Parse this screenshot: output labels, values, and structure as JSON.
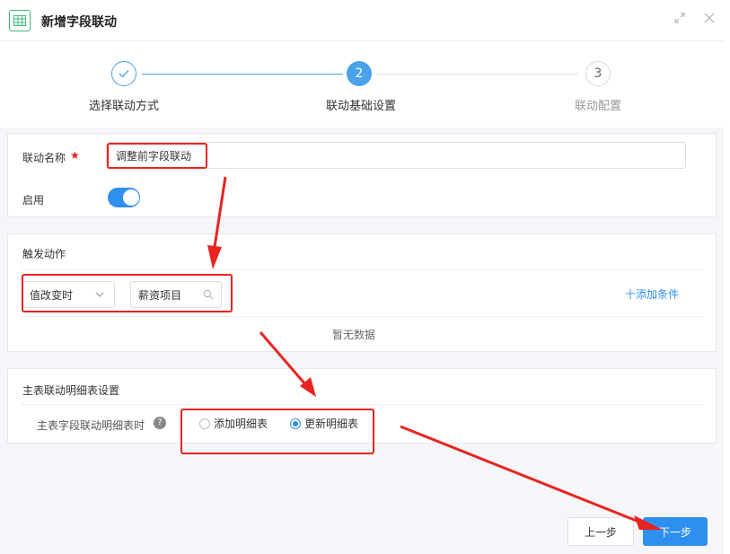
{
  "window": {
    "title": "新增字段联动",
    "app_icon": "table-icon",
    "expand_icon": "expand-icon",
    "close_icon": "close-icon"
  },
  "steps": [
    {
      "label": "选择联动方式",
      "state": "done",
      "number": ""
    },
    {
      "label": "联动基础设置",
      "state": "active",
      "number": "2"
    },
    {
      "label": "联动配置",
      "state": "pending",
      "number": "3"
    }
  ],
  "basic": {
    "name_label": "联动名称",
    "required_mark": "★",
    "name_value": "调整前字段联动",
    "enable_label": "启用",
    "enable_on": true
  },
  "trigger": {
    "title": "触发动作",
    "condition_select": "值改变时",
    "field_value": "薪资项目",
    "add_condition": "十添加条件",
    "empty_text": "暂无数据"
  },
  "detail": {
    "title": "主表联动明细表设置",
    "field_label": "主表字段联动明细表时",
    "options": [
      {
        "label": "添加明细表",
        "checked": false
      },
      {
        "label": "更新明细表",
        "checked": true
      }
    ]
  },
  "footer": {
    "prev_label": "上一步",
    "next_label": "下一步"
  },
  "colors": {
    "accent": "#2f8fef",
    "annotation": "#e8241f",
    "step_done": "#4aa3ea",
    "muted": "#999999"
  }
}
